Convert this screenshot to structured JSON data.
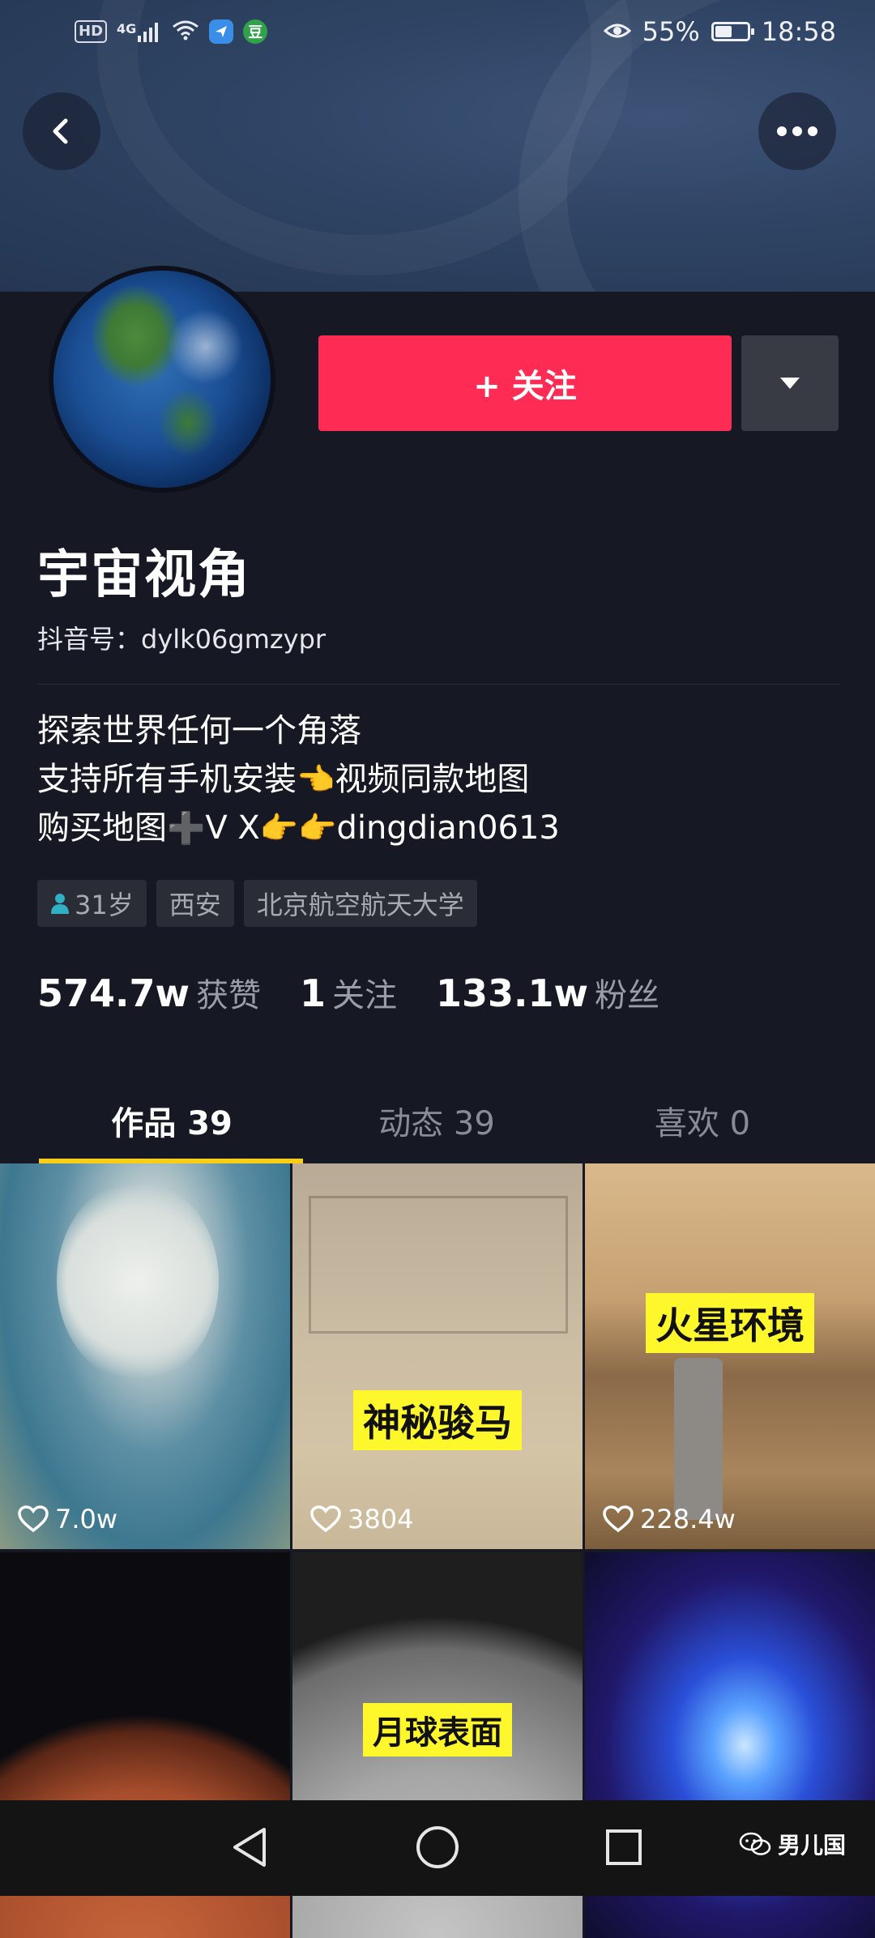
{
  "status_bar": {
    "hd": "HD",
    "network": "4G",
    "app_badge": "豆",
    "battery_percent": "55%",
    "battery_level": 0.55,
    "time": "18:58"
  },
  "profile": {
    "follow_label": "+ 关注",
    "name": "宇宙视角",
    "douyin_id": "抖音号：dylk06gmzypr",
    "bio": {
      "line1": "探索世界任何一个角落",
      "line2_a": "支持所有手机安装",
      "line2_b": "视频同款地图",
      "line3_a": "购买地图",
      "line3_b": "V X",
      "line3_c": "dingdian0613"
    },
    "tags": {
      "age": "31岁",
      "city": "西安",
      "school": "北京航空航天大学"
    },
    "stats": {
      "likes_num": "574.7w",
      "likes_label": "获赞",
      "following_num": "1",
      "following_label": "关注",
      "followers_num": "133.1w",
      "followers_label": "粉丝"
    }
  },
  "tabs": [
    {
      "label": "作品 39",
      "active": true
    },
    {
      "label": "动态 39",
      "active": false
    },
    {
      "label": "喜欢 0",
      "active": false
    }
  ],
  "videos": [
    {
      "caption": "",
      "likes": "7.0w"
    },
    {
      "caption": "神秘骏马",
      "likes": "3804"
    },
    {
      "caption": "火星环境",
      "likes": "228.4w"
    },
    {
      "caption": "",
      "likes": ""
    },
    {
      "caption": "月球表面",
      "likes": ""
    },
    {
      "caption": "",
      "likes": ""
    }
  ],
  "watermark": "男儿国",
  "colors": {
    "accent_red": "#fe2c55",
    "tab_indicator": "#face15",
    "background": "#161823",
    "caption_yellow": "#fef72b"
  }
}
